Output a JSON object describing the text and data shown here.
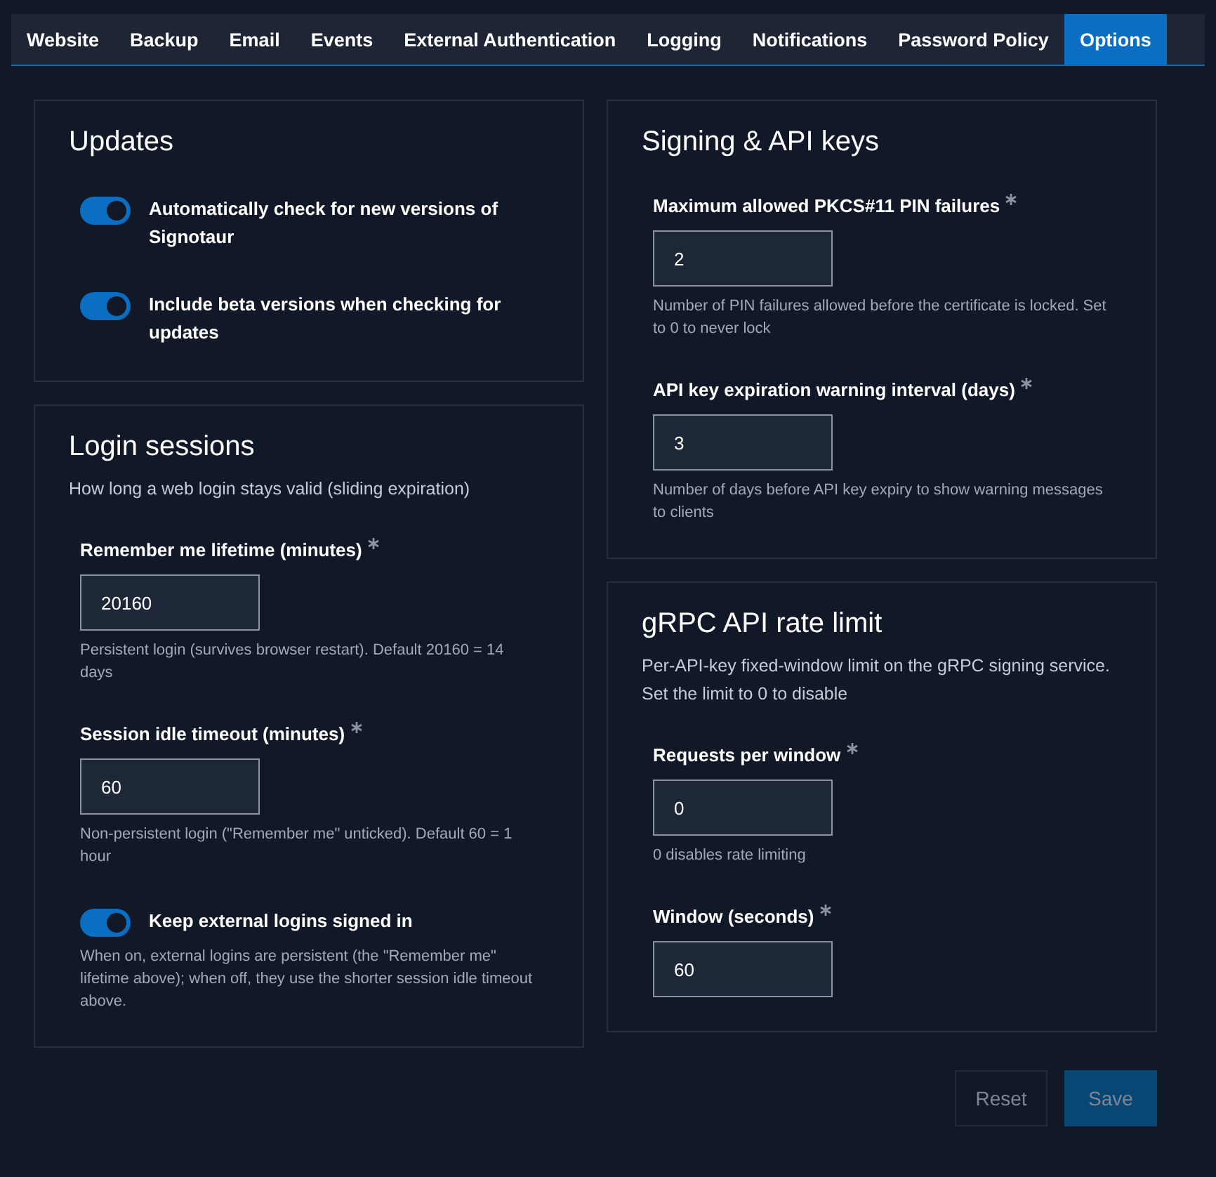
{
  "tabs": [
    {
      "label": "Website",
      "selected": false
    },
    {
      "label": "Backup",
      "selected": false
    },
    {
      "label": "Email",
      "selected": false
    },
    {
      "label": "Events",
      "selected": false
    },
    {
      "label": "External Authentication",
      "selected": false
    },
    {
      "label": "Logging",
      "selected": false
    },
    {
      "label": "Notifications",
      "selected": false
    },
    {
      "label": "Password Policy",
      "selected": false
    },
    {
      "label": "Options",
      "selected": true
    }
  ],
  "columns": [
    [
      {
        "title": "Updates",
        "items": [
          {
            "kind": "toggle",
            "label": "Automatically check for new versions of Signotaur",
            "on": true
          },
          {
            "kind": "toggle",
            "label": "Include beta versions when checking for updates",
            "on": true
          }
        ]
      },
      {
        "title": "Login sessions",
        "description": "How long a web login stays valid (sliding expiration)",
        "items": [
          {
            "kind": "field",
            "label": "Remember me lifetime (minutes)",
            "required": true,
            "value": "20160",
            "help": "Persistent login (survives browser restart). Default 20160 = 14 days"
          },
          {
            "kind": "field",
            "label": "Session idle timeout (minutes)",
            "required": true,
            "value": "60",
            "help": "Non-persistent login (\"Remember me\" unticked). Default 60 = 1 hour"
          },
          {
            "kind": "toggle",
            "label": "Keep external logins signed in",
            "on": true,
            "help": "When on, external logins are persistent (the \"Remember me\" lifetime above); when off, they use the shorter session idle timeout above."
          }
        ]
      }
    ],
    [
      {
        "title": "Signing & API keys",
        "items": [
          {
            "kind": "field",
            "label": "Maximum allowed PKCS#11 PIN failures",
            "required": true,
            "value": "2",
            "help": "Number of PIN failures allowed before the certificate is locked. Set to 0 to never lock"
          },
          {
            "kind": "field",
            "label": "API key expiration warning interval (days)",
            "required": true,
            "value": "3",
            "help": "Number of days before API key expiry to show warning messages to clients"
          }
        ]
      },
      {
        "title": "gRPC API rate limit",
        "description": "Per-API-key fixed-window limit on the gRPC signing service. Set the limit to 0 to disable",
        "items": [
          {
            "kind": "field",
            "label": "Requests per window",
            "required": true,
            "value": "0",
            "help": "0 disables rate limiting"
          },
          {
            "kind": "field",
            "label": "Window (seconds)",
            "required": true,
            "value": "60"
          }
        ]
      }
    ]
  ],
  "buttons": [
    {
      "label": "Reset",
      "kind": "secondary",
      "disabled": true
    },
    {
      "label": "Save",
      "kind": "primary",
      "disabled": true
    }
  ]
}
